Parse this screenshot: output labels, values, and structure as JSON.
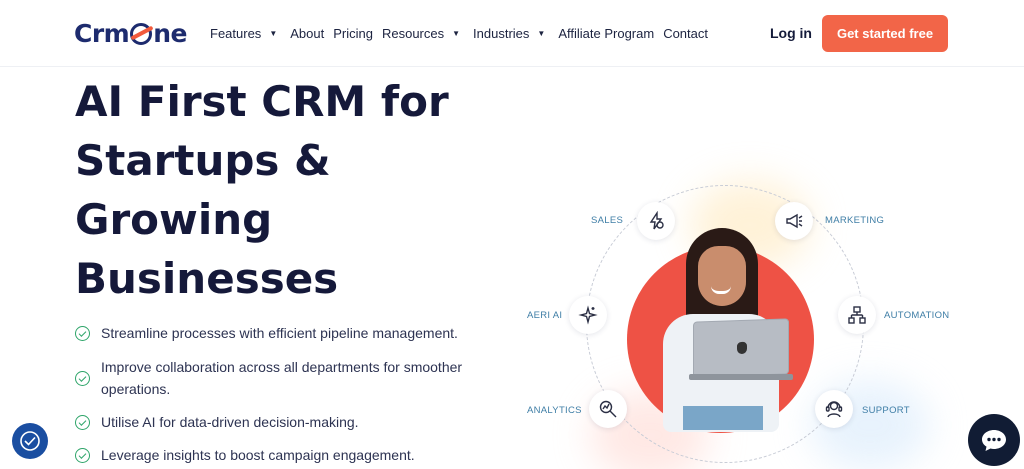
{
  "header": {
    "logo_text": "CrmOne",
    "nav": [
      {
        "label": "Features",
        "caret": true
      },
      {
        "label": "About",
        "caret": false
      },
      {
        "label": "Pricing",
        "caret": false
      },
      {
        "label": "Resources",
        "caret": true
      },
      {
        "label": "Industries",
        "caret": true
      },
      {
        "label": "Affiliate Program",
        "caret": false
      },
      {
        "label": "Contact",
        "caret": false
      }
    ],
    "login_label": "Log in",
    "cta_label": "Get started free"
  },
  "hero": {
    "title_lines": [
      "AI First CRM for",
      "Startups &",
      "Growing",
      "Businesses"
    ],
    "bullets": [
      "Streamline processes with efficient pipeline management.",
      "Improve collaboration across all departments for smoother operations.",
      "Utilise AI for data-driven decision-making.",
      "Leverage insights to boost campaign engagement."
    ]
  },
  "illustration": {
    "nodes": [
      {
        "label": "SALES",
        "icon": "lightning-icon"
      },
      {
        "label": "MARKETING",
        "icon": "megaphone-icon"
      },
      {
        "label": "AERI AI",
        "icon": "sparkle-icon"
      },
      {
        "label": "AUTOMATION",
        "icon": "flowchart-icon"
      },
      {
        "label": "ANALYTICS",
        "icon": "magnifier-chart-icon"
      },
      {
        "label": "SUPPORT",
        "icon": "headset-icon"
      }
    ]
  },
  "colors": {
    "brand_navy": "#1d2b6e",
    "cta_orange": "#f26548",
    "disc_red": "#ee5245",
    "check_green": "#2fa56a",
    "label_blue": "#3f7ea6",
    "chat_dark": "#111c34",
    "a11y_blue": "#1a4ea1"
  },
  "widgets": {
    "accessibility_icon": "accessibility-icon",
    "chat_icon": "chat-bubble-icon"
  }
}
